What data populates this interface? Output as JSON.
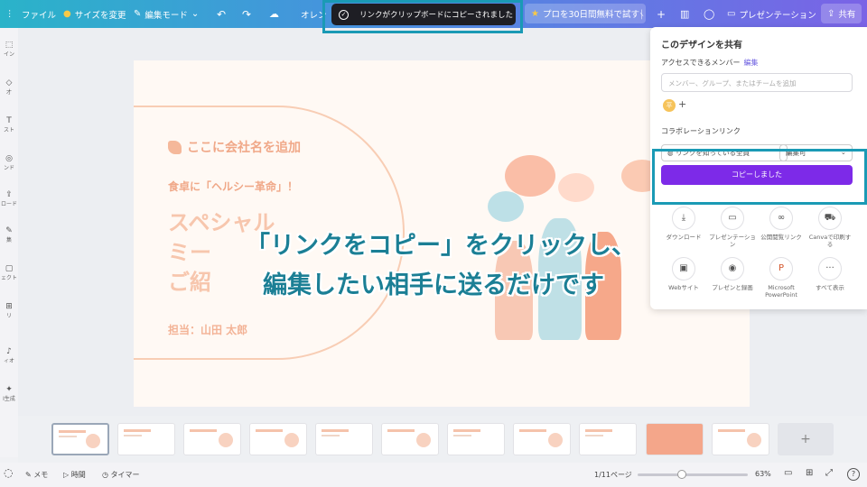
{
  "topbar": {
    "file": "ファイル",
    "resize": "サイズを変更",
    "edit_mode": "編集モード",
    "brand_label": "オレン",
    "pro_trial": "プロを30日間無料で試す",
    "present": "プレゼンテーション",
    "share": "共有"
  },
  "toast": {
    "message": "リンクがクリップボードにコピーされました"
  },
  "rail": [
    {
      "label": "イン",
      "icon": "⬚"
    },
    {
      "label": "才",
      "icon": "◇"
    },
    {
      "label": "スト",
      "icon": "T"
    },
    {
      "label": "ンド",
      "icon": "◎"
    },
    {
      "label": "ロード",
      "icon": "⇪"
    },
    {
      "label": "集",
      "icon": "✎"
    },
    {
      "label": "ェクト",
      "icon": "▢"
    },
    {
      "label": "リ",
      "icon": "⊞"
    },
    {
      "label": "ィオ",
      "icon": "♪"
    },
    {
      "label": "I生成",
      "icon": "✦"
    }
  ],
  "slide": {
    "company": "ここに会社名を追加",
    "tagline": "食卓に「ヘルシー革命」！",
    "big1": "スペシャル",
    "big2": "ミー",
    "big3": "ご紹",
    "author": "担当：山田 太郎"
  },
  "caption": {
    "line1": "「リンクをコピー」をクリックし、",
    "line2": "編集したい相手に送るだけです"
  },
  "share_panel": {
    "title": "このデザインを共有",
    "members_label": "アクセスできるメンバー",
    "edit_link": "編集",
    "add_placeholder": "メンバー、グループ、またはチームを追加",
    "avatar_initial": "平",
    "collab_label": "コラボレーションリンク",
    "access_select": "リンクを知っている全員",
    "role_select": "編集可",
    "copied_button": "コピーしました",
    "options": [
      {
        "label": "ダウンロード",
        "icon": "⤓"
      },
      {
        "label": "プレゼンテーション",
        "icon": "▭"
      },
      {
        "label": "公開閲覧リンク",
        "icon": "∞"
      },
      {
        "label": "Canvaで印刷する",
        "icon": "⛟"
      },
      {
        "label": "Webサイト",
        "icon": "▣"
      },
      {
        "label": "プレゼンと録画",
        "icon": "◉"
      },
      {
        "label": "Microsoft PowerPoint",
        "icon": "P"
      },
      {
        "label": "すべて表示",
        "icon": "···"
      }
    ]
  },
  "thumbnails": {
    "count": 11,
    "active_index": 0,
    "add_label": "+"
  },
  "bottombar": {
    "notes": "メモ",
    "time": "時間",
    "timer": "タイマー",
    "page_indicator": "1/11ページ",
    "zoom": "63%",
    "zoom_level": 0.4,
    "help": "?"
  },
  "colors": {
    "accent_purple": "#7d2ae8",
    "caption_blue": "#1b7f95",
    "highlight_frame": "#1a9ab5",
    "slide_peach": "#f7c6ad"
  }
}
